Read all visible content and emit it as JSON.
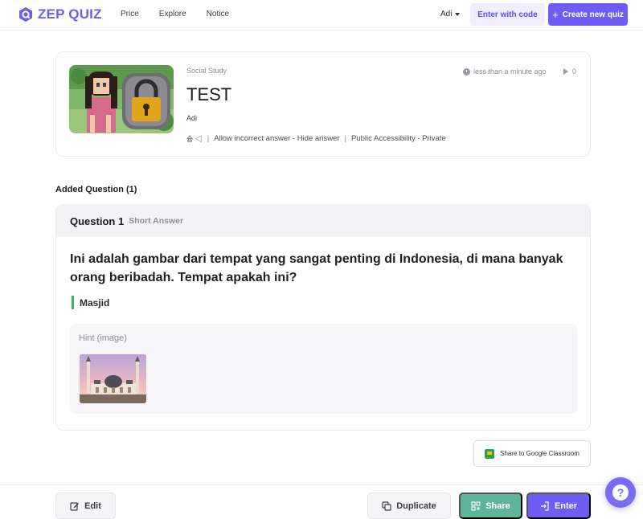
{
  "header": {
    "logo_text": "ZEP QUIZ",
    "nav": [
      "Price",
      "Explore",
      "Notice"
    ],
    "user_name": "Adi",
    "enter_code_label": "Enter with code",
    "create_label": "Create new quiz",
    "brand_color": "#6e5cf5"
  },
  "quiz": {
    "category": "Social Study",
    "title": "TEST",
    "author": "Adi",
    "updated": "less than a minute ago",
    "plays": "0",
    "language_glyph": "슝 ◁",
    "answer_setting": "Allow incorrect answer - Hide answer",
    "access_setting": "Public Accessibility - Private"
  },
  "added_label": "Added Question (1)",
  "question": {
    "number_label": "Question 1",
    "type_label": "Short Answer",
    "text": "Ini adalah gambar dari tempat yang sangat penting di Indonesia, di mana banyak orang beribadah. Tempat apakah ini?",
    "answer": "Masjid",
    "hint_label": "Hint (image)",
    "answer_color": "#39b26b"
  },
  "google_classroom_label": "Share to Google Classroom",
  "bottom": {
    "edit_label": "Edit",
    "duplicate_label": "Duplicate",
    "share_label": "Share",
    "enter_label": "Enter"
  },
  "help_label": "?"
}
